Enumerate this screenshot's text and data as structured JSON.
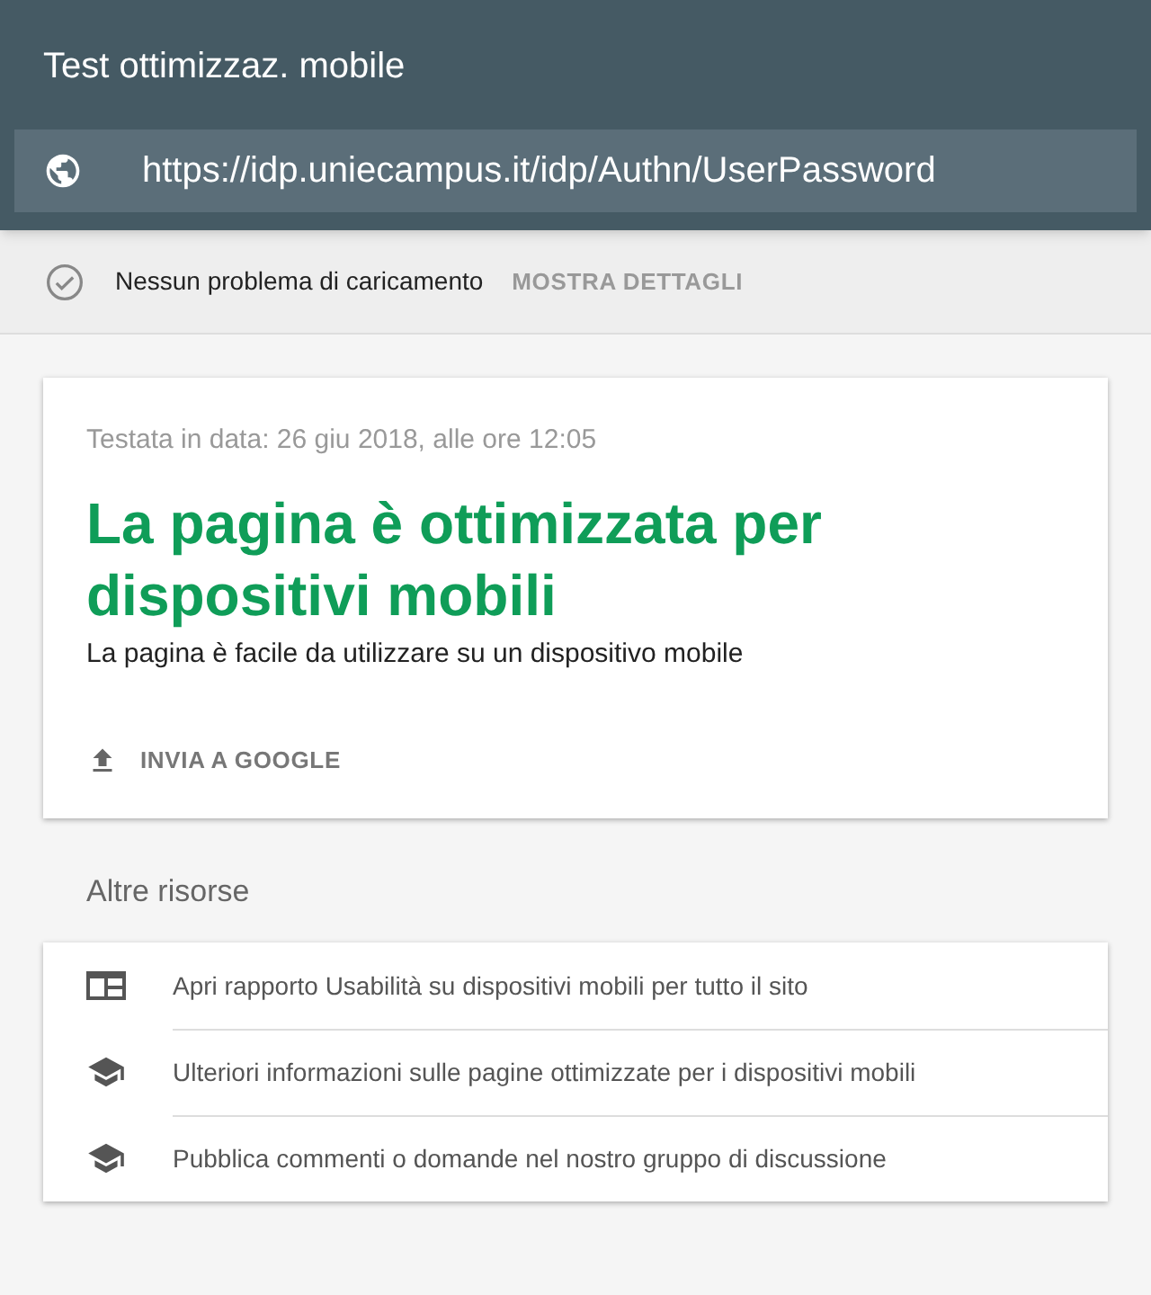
{
  "header": {
    "title": "Test ottimizzaz. mobile",
    "url": "https://idp.uniecampus.it/idp/Authn/UserPassword"
  },
  "status": {
    "text": "Nessun problema di caricamento",
    "action": "MOSTRA DETTAGLI"
  },
  "result": {
    "tested": "Testata in data: 26 giu 2018, alle ore 12:05",
    "heading": "La pagina è ottimizzata per dispositivi mobili",
    "description": "La pagina è facile da utilizzare su un dispositivo mobile",
    "action": "INVIA A GOOGLE"
  },
  "resources": {
    "title": "Altre risorse",
    "items": [
      {
        "kind": "report",
        "label": "Apri rapporto Usabilità su dispositivi mobili per tutto il sito"
      },
      {
        "kind": "learn",
        "label": "Ulteriori informazioni sulle pagine ottimizzate per i dispositivi mobili"
      },
      {
        "kind": "learn",
        "label": "Pubblica commenti o domande nel nostro gruppo di discussione"
      }
    ]
  }
}
